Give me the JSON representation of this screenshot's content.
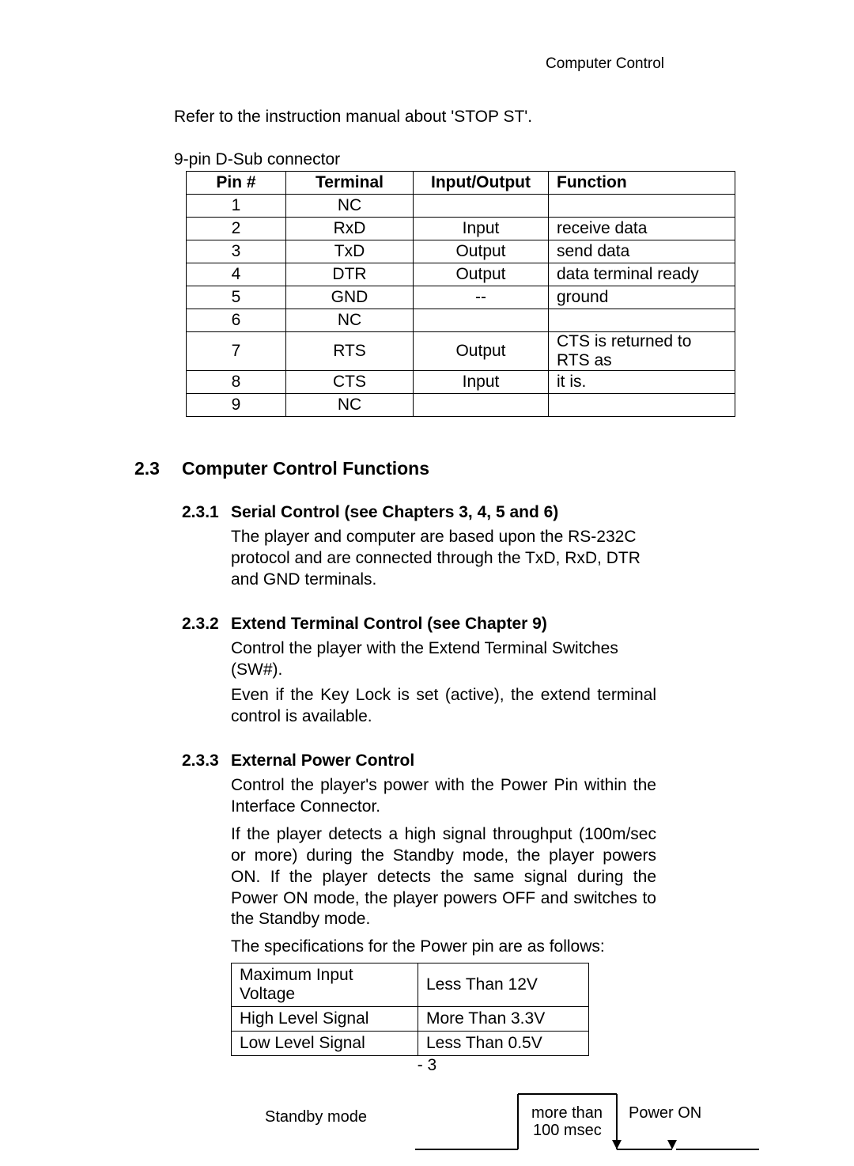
{
  "header": "Computer Control",
  "intro": "Refer to the instruction manual about 'STOP ST'.",
  "table_label": "9-pin D-Sub connector",
  "pin_headers": {
    "pin": "Pin #",
    "term": "Terminal",
    "io": "Input/Output",
    "func": "Function"
  },
  "pins": [
    {
      "pin": "1",
      "term": "NC",
      "io": "",
      "func": ""
    },
    {
      "pin": "2",
      "term": "RxD",
      "io": "Input",
      "func": "receive data"
    },
    {
      "pin": "3",
      "term": "TxD",
      "io": "Output",
      "func": "send data"
    },
    {
      "pin": "4",
      "term": "DTR",
      "io": "Output",
      "func": "data terminal ready"
    },
    {
      "pin": "5",
      "term": "GND",
      "io": "--",
      "func": "ground"
    },
    {
      "pin": "6",
      "term": "NC",
      "io": "",
      "func": ""
    },
    {
      "pin": "7",
      "term": "RTS",
      "io": "Output",
      "func": "CTS is returned to RTS as"
    },
    {
      "pin": "8",
      "term": "CTS",
      "io": "Input",
      "func": "it is."
    },
    {
      "pin": "9",
      "term": "NC",
      "io": "",
      "func": ""
    }
  ],
  "section": {
    "num": "2.3",
    "title": "Computer Control Functions"
  },
  "s1": {
    "num": "2.3.1",
    "title": "Serial Control (see Chapters 3, 4, 5 and 6)",
    "p1": "The player and computer are based upon the RS-232C protocol and are connected through the TxD, RxD, DTR and GND terminals."
  },
  "s2": {
    "num": "2.3.2",
    "title": "Extend Terminal Control (see Chapter 9)",
    "p1": "Control the player with the Extend Terminal Switches (SW#).",
    "p2": "Even if the Key Lock is set (active), the extend terminal control is available."
  },
  "s3": {
    "num": "2.3.3",
    "title": "External Power Control",
    "p1": "Control the player's power with the Power Pin within the Interface Connector.",
    "p2": "If the player detects a high signal throughput (100m/sec or more) during the Standby mode, the player powers ON.  If the player detects the same signal during the Power ON mode, the player powers OFF and switches to the Standby mode.",
    "p3": "The specifications for the Power pin are as follows:"
  },
  "spec": [
    {
      "k": "Maximum Input Voltage",
      "v": "Less Than  12V"
    },
    {
      "k": "High Level Signal",
      "v": "More Than  3.3V"
    },
    {
      "k": "Low Level Signal",
      "v": "Less Than 0.5V"
    }
  ],
  "diagram": {
    "left": "Standby mode",
    "mid_top": "more than",
    "mid_bot": "100 msec",
    "right": "Power ON"
  },
  "page_number": "- 3"
}
